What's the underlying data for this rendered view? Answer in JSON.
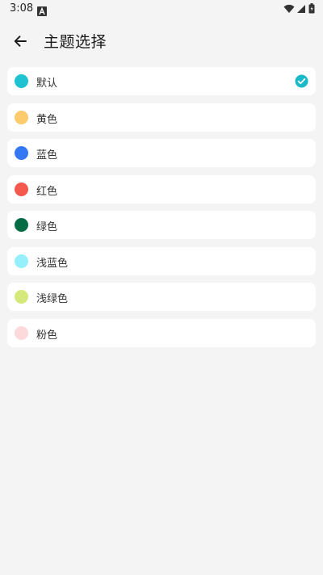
{
  "status_bar": {
    "time": "3:08",
    "notification_icon": "a-icon",
    "icons": [
      "wifi-icon",
      "signal-icon",
      "battery-icon"
    ]
  },
  "header": {
    "title": "主题选择",
    "back_icon": "arrow-left-icon"
  },
  "accent_color": "#1ab9c9",
  "themes": [
    {
      "label": "默认",
      "color": "#1ec2d0",
      "selected": true
    },
    {
      "label": "黄色",
      "color": "#fccb6b",
      "selected": false
    },
    {
      "label": "蓝色",
      "color": "#3478f6",
      "selected": false
    },
    {
      "label": "红色",
      "color": "#f5594e",
      "selected": false
    },
    {
      "label": "绿色",
      "color": "#056b45",
      "selected": false
    },
    {
      "label": "浅蓝色",
      "color": "#95f0fc",
      "selected": false
    },
    {
      "label": "浅绿色",
      "color": "#d5e87b",
      "selected": false
    },
    {
      "label": "粉色",
      "color": "#fdd9db",
      "selected": false
    }
  ]
}
